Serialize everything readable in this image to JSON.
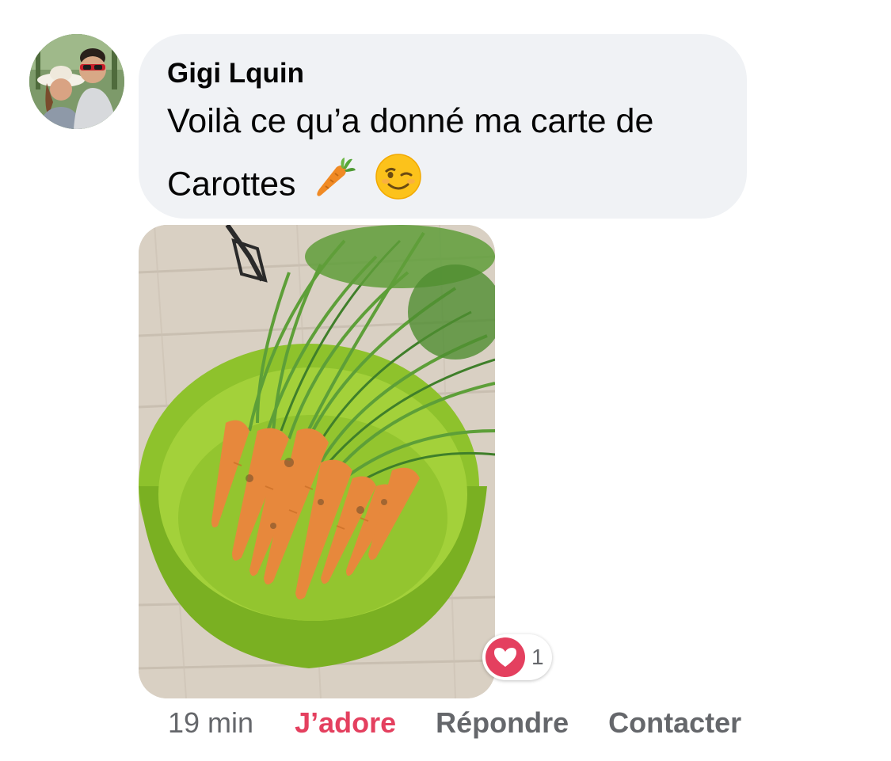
{
  "comment": {
    "author": "Gigi Lquin",
    "text_line1": "Voilà ce qu’a donné ma carte de",
    "text_line2": "Carottes",
    "emojis": [
      "carrot-emoji",
      "winking-face-emoji"
    ]
  },
  "attachment": {
    "icon": "photo-carrots-in-green-bowl"
  },
  "reactions": {
    "type": "heart",
    "count": "1",
    "color": "#e4405f"
  },
  "actions": {
    "timestamp": "19 min",
    "like_label": "J’adore",
    "reply_label": "Répondre",
    "contact_label": "Contacter"
  },
  "colors": {
    "bubble": "#f0f2f5",
    "text": "#050505",
    "muted": "#65676b",
    "accent": "#e4405f"
  }
}
